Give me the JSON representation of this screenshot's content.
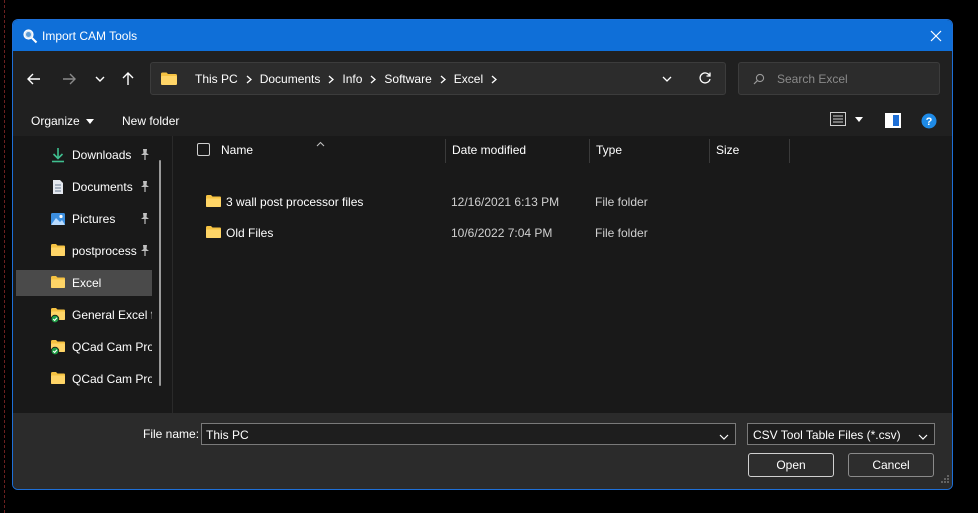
{
  "window": {
    "title": "Import CAM Tools",
    "title_icon": "magnifier-app-icon",
    "close_icon": "close-icon"
  },
  "navigation": {
    "back_icon": "arrow-left-icon",
    "forward_icon": "arrow-right-icon",
    "recent_icon": "chevron-down-icon",
    "up_icon": "arrow-up-icon"
  },
  "address_bar": {
    "folder_icon": "folder-icon",
    "breadcrumbs": [
      "This PC",
      "Documents",
      "Info",
      "Software",
      "Excel"
    ],
    "dropdown_icon": "chevron-down-icon",
    "refresh_icon": "refresh-icon"
  },
  "search": {
    "placeholder": "Search Excel",
    "value": "",
    "icon": "search-icon"
  },
  "toolbar": {
    "organize_label": "Organize",
    "new_folder_label": "New folder",
    "view_icon": "details-view-icon",
    "preview_icon": "preview-pane-icon",
    "help_icon": "help-icon"
  },
  "sidebar": {
    "items": [
      {
        "label": "Downloads",
        "icon": "download-arrow-icon",
        "pinned": true,
        "selected": false
      },
      {
        "label": "Documents",
        "icon": "documents-icon",
        "pinned": true,
        "selected": false
      },
      {
        "label": "Pictures",
        "icon": "pictures-icon",
        "pinned": true,
        "selected": false
      },
      {
        "label": "postprocess",
        "icon": "folder-icon",
        "pinned": true,
        "selected": false
      },
      {
        "label": "Excel",
        "icon": "folder-icon",
        "pinned": false,
        "selected": true
      },
      {
        "label": "General Excel fi",
        "icon": "synced-folder-icon",
        "pinned": false,
        "selected": false
      },
      {
        "label": "QCad Cam Pro",
        "icon": "synced-folder-icon",
        "pinned": false,
        "selected": false
      },
      {
        "label": "QCad Cam Pro",
        "icon": "folder-icon",
        "pinned": false,
        "selected": false
      }
    ]
  },
  "file_list": {
    "columns": [
      "Name",
      "Date modified",
      "Type",
      "Size"
    ],
    "rows": [
      {
        "name": "3 wall post processor files",
        "date_modified": "12/16/2021 6:13 PM",
        "type": "File folder",
        "size": ""
      },
      {
        "name": "Old Files",
        "date_modified": "10/6/2022 7:04 PM",
        "type": "File folder",
        "size": ""
      }
    ]
  },
  "footer": {
    "file_name_label": "File name:",
    "file_name_value": "This PC",
    "file_type_value": "CSV Tool Table Files (*.csv)",
    "open_label": "Open",
    "cancel_label": "Cancel"
  },
  "colors": {
    "title_bar": "#0f6fd8",
    "background": "#191919",
    "folder": "#f5c242",
    "accent_blue": "#1e6fd6"
  }
}
